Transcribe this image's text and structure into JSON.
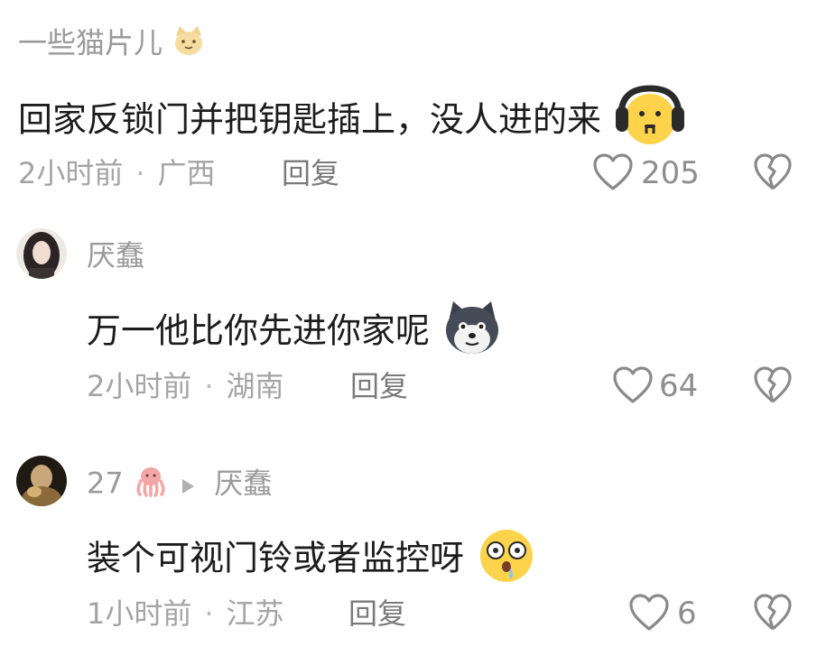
{
  "comments": [
    {
      "user": "一些猫片儿",
      "text": "回家反锁门并把钥匙插上，没人进的来",
      "time": "2小时前",
      "location": "广西",
      "reply_label": "回复",
      "likes": "205",
      "user_emoji": "cat-face-emoji",
      "text_emoji": "headphones-face-emoji"
    },
    {
      "user": "厌蠢",
      "text": "万一他比你先进你家呢",
      "time": "2小时前",
      "location": "湖南",
      "reply_label": "回复",
      "likes": "64",
      "text_emoji": "wolf-dog-emoji"
    },
    {
      "user": "27",
      "reply_to": "厌蠢",
      "text": "装个可视门铃或者监控呀",
      "time": "1小时前",
      "location": "江苏",
      "reply_label": "回复",
      "likes": "6",
      "user_emoji": "octopus-emoji",
      "text_emoji": "shocked-drool-emoji"
    }
  ],
  "separator": "·",
  "colors": {
    "text": "#1c1c1c",
    "muted": "#a4a4a4",
    "reply": "#7a7a7a",
    "icon": "#8a8a8a"
  }
}
